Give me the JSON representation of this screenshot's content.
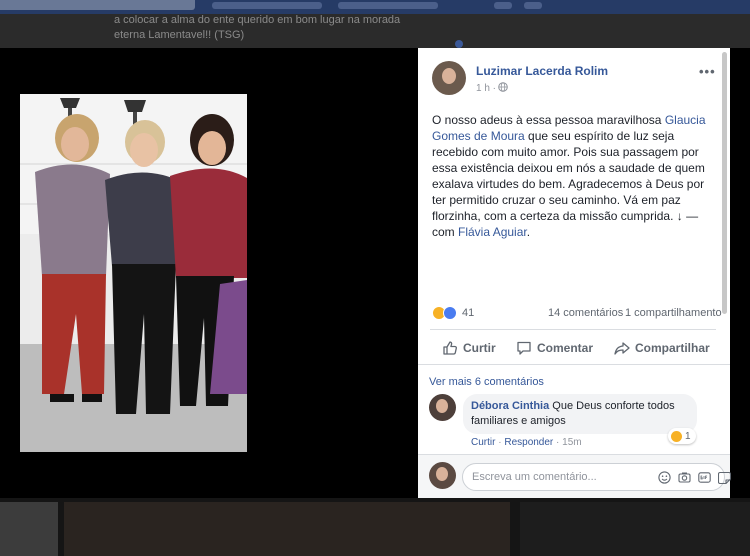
{
  "background": {
    "feed_text_line1": "a colocar a alma do ente querido em bom lugar na morada",
    "feed_text_line2": "eterna Lamentavel!! (TSG)"
  },
  "post": {
    "author": "Luzimar Lacerda Rolim",
    "time": "1 h ·",
    "privacy_icon": "globe-icon",
    "menu_label": "•••",
    "text_before_mention": "O nosso adeus à essa pessoa maravilhosa ",
    "mention": "Glaucia Gomes de Moura",
    "text_after_mention": " que seu espírito de luz seja recebido com muito amor. Pois sua passagem por essa existência deixou em nós a saudade de quem exalava virtudes do bem. Agradecemos à Deus por ter permitido cruzar o seu caminho. Vá em paz florzinha, com a certeza da missão cumprida. ↓ — com ",
    "tagged": "Flávia Aguiar",
    "tagged_suffix": "."
  },
  "stats": {
    "reaction_types": [
      "sad",
      "like"
    ],
    "reaction_count": "41",
    "comments": "14 comentários",
    "shares": "1 compartilhamento"
  },
  "actions": {
    "like": "Curtir",
    "comment": "Comentar",
    "share": "Compartilhar"
  },
  "comments": {
    "more_label": "Ver mais 6 comentários",
    "items": [
      {
        "name": "Débora Cinthia",
        "text": "Que Deus conforte todos familiares e amigos",
        "reaction_count": "1",
        "like_label": "Curtir",
        "reply_label": "Responder",
        "time": "15m"
      }
    ]
  },
  "composer": {
    "placeholder": "Escreva um comentário...",
    "icons": [
      "emoji-icon",
      "camera-icon",
      "gif-icon",
      "sticker-icon"
    ]
  },
  "colors": {
    "link": "#365899",
    "like_blue": "#4a7cf0",
    "sad_yellow": "#f7b125",
    "topbar": "#263b66"
  }
}
